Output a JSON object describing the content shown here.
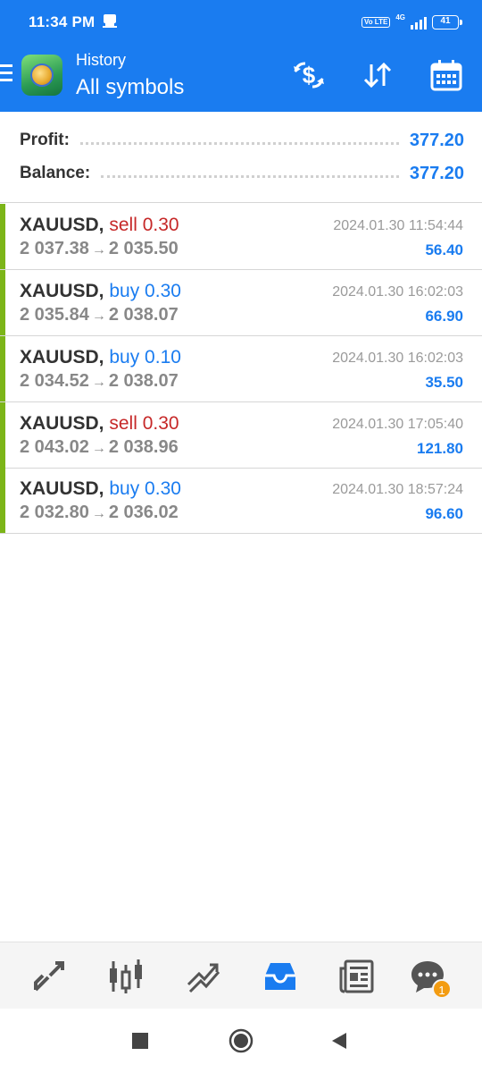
{
  "status_bar": {
    "time": "11:34 PM",
    "volte": "Vo LTE",
    "network": "4G",
    "battery": "41"
  },
  "header": {
    "subtitle": "History",
    "title": "All symbols",
    "icons": [
      "menu-icon",
      "app-logo",
      "currency-exchange-icon",
      "sort-icon",
      "calendar-icon"
    ]
  },
  "summary": {
    "profit_label": "Profit:",
    "profit_value": "377.20",
    "balance_label": "Balance:",
    "balance_value": "377.20"
  },
  "deals": [
    {
      "symbol": "XAUUSD,",
      "type": "sell 0.30",
      "open": "2 037.38",
      "close": "2 035.50",
      "time": "2024.01.30 11:54:44",
      "profit": "56.40"
    },
    {
      "symbol": "XAUUSD,",
      "type": "buy 0.30",
      "open": "2 035.84",
      "close": "2 038.07",
      "time": "2024.01.30 16:02:03",
      "profit": "66.90"
    },
    {
      "symbol": "XAUUSD,",
      "type": "buy 0.10",
      "open": "2 034.52",
      "close": "2 038.07",
      "time": "2024.01.30 16:02:03",
      "profit": "35.50"
    },
    {
      "symbol": "XAUUSD,",
      "type": "sell 0.30",
      "open": "2 043.02",
      "close": "2 038.96",
      "time": "2024.01.30 17:05:40",
      "profit": "121.80"
    },
    {
      "symbol": "XAUUSD,",
      "type": "buy 0.30",
      "open": "2 032.80",
      "close": "2 036.02",
      "time": "2024.01.30 18:57:24",
      "profit": "96.60"
    }
  ],
  "arrow": "→",
  "bottom_nav": {
    "items": [
      "quotes-icon",
      "chart-icon",
      "trade-icon",
      "history-icon",
      "news-icon",
      "chat-icon"
    ],
    "active": "history-icon",
    "chat_badge": "1"
  },
  "colors": {
    "accent": "#1a7cf0",
    "sell": "#c62828",
    "buy": "#1a7cf0",
    "profit_bar": "#7cb518"
  }
}
